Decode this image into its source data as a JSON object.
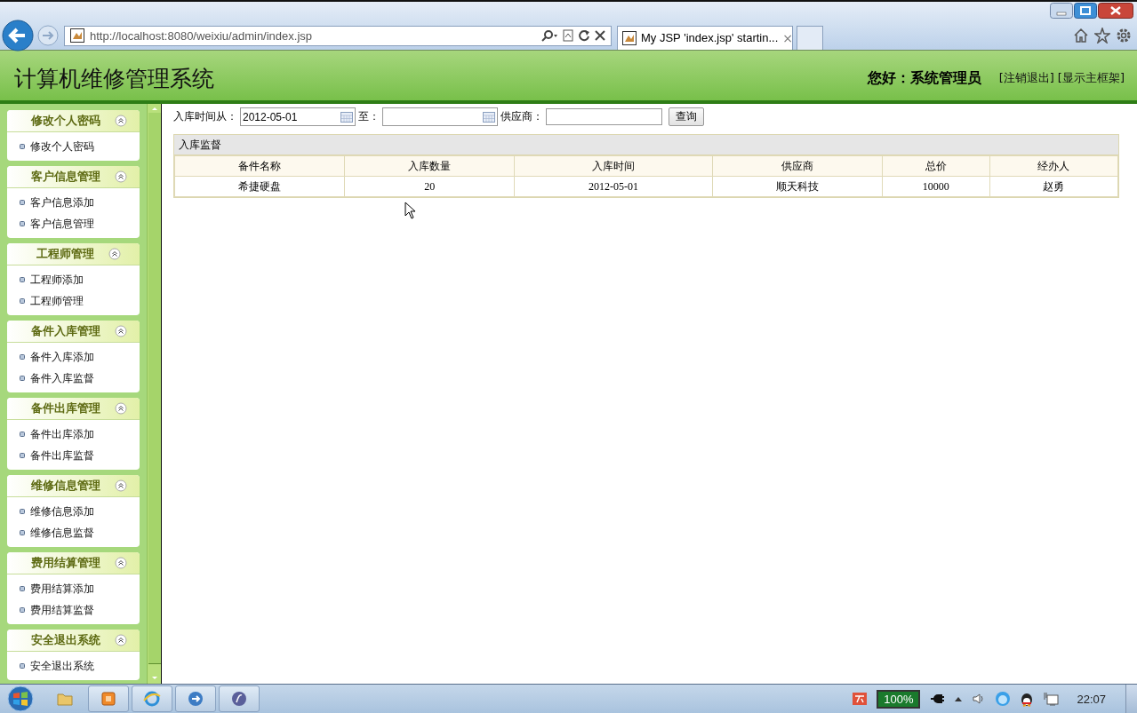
{
  "browser": {
    "address": "http://localhost:8080/weixiu/admin/index.jsp",
    "tabs": [
      {
        "label": "My JSP 'index.jsp' startin...",
        "selected": true,
        "close": "×"
      }
    ]
  },
  "header": {
    "title": "计算机维修管理系统",
    "greeting": "您好：系统管理员",
    "links": [
      "[注销退出]",
      "[显示主框架]"
    ]
  },
  "sidebar": {
    "groups": [
      {
        "title": "修改个人密码",
        "expanded": true,
        "items": [
          "修改个人密码"
        ]
      },
      {
        "title": "客户信息管理",
        "expanded": true,
        "items": [
          "客户信息添加",
          "客户信息管理"
        ]
      },
      {
        "title": "工程师管理",
        "expanded": true,
        "items": [
          "工程师添加",
          "工程师管理"
        ]
      },
      {
        "title": "备件入库管理",
        "expanded": true,
        "items": [
          "备件入库添加",
          "备件入库监督"
        ]
      },
      {
        "title": "备件出库管理",
        "expanded": true,
        "items": [
          "备件出库添加",
          "备件出库监督"
        ]
      },
      {
        "title": "维修信息管理",
        "expanded": true,
        "items": [
          "维修信息添加",
          "维修信息监督"
        ]
      },
      {
        "title": "费用结算管理",
        "expanded": true,
        "items": [
          "费用结算添加",
          "费用结算监督"
        ]
      },
      {
        "title": "安全退出系统",
        "expanded": true,
        "items": [
          "安全退出系统"
        ]
      }
    ]
  },
  "filter": {
    "from_label": "入库时间从：",
    "from_value": "2012-05-01",
    "to_label": "至：",
    "supplier_label": "供应商：",
    "button": "查询"
  },
  "table": {
    "title": "入库监督",
    "columns": [
      "备件名称",
      "入库数量",
      "入库时间",
      "供应商",
      "总价",
      "经办人"
    ],
    "rows": [
      [
        "希捷硬盘",
        "20",
        "2012-05-01",
        "顺天科技",
        "10000",
        "赵勇"
      ]
    ]
  },
  "taskbar": {
    "battery": "100%",
    "clock": "22:07"
  }
}
